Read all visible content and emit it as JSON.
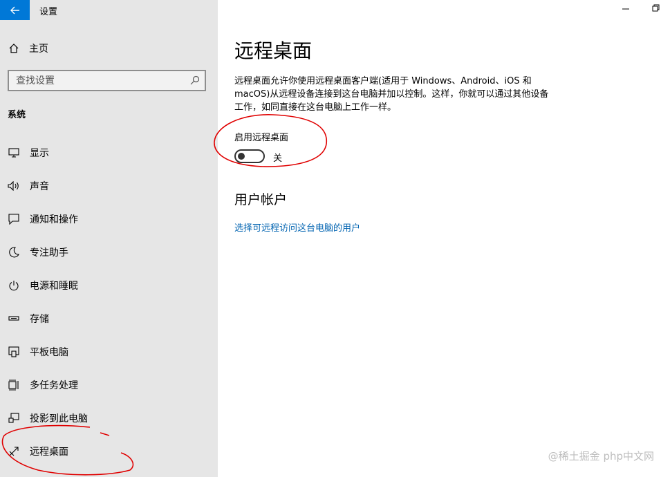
{
  "app": {
    "title": "设置"
  },
  "sidebar": {
    "home_label": "主页",
    "search_placeholder": "查找设置",
    "section": "系统",
    "items": [
      {
        "label": "显示",
        "icon": "monitor-icon"
      },
      {
        "label": "声音",
        "icon": "speaker-icon"
      },
      {
        "label": "通知和操作",
        "icon": "notification-icon"
      },
      {
        "label": "专注助手",
        "icon": "moon-icon"
      },
      {
        "label": "电源和睡眠",
        "icon": "power-icon"
      },
      {
        "label": "存储",
        "icon": "storage-icon"
      },
      {
        "label": "平板电脑",
        "icon": "tablet-icon"
      },
      {
        "label": "多任务处理",
        "icon": "multitask-icon"
      },
      {
        "label": "投影到此电脑",
        "icon": "project-icon"
      },
      {
        "label": "远程桌面",
        "icon": "remote-desktop-icon"
      }
    ]
  },
  "main": {
    "title": "远程桌面",
    "description": "远程桌面允许你使用远程桌面客户端(适用于 Windows、Android、iOS 和 macOS)从远程设备连接到这台电脑并加以控制。这样，你就可以通过其他设备工作，如同直接在这台电脑上工作一样。",
    "toggle_label": "启用远程桌面",
    "toggle_state": "关",
    "toggle_on": false,
    "user_accounts_title": "用户帐户",
    "user_accounts_link": "选择可远程访问这台电脑的用户"
  },
  "watermark": "@稀土掘金 php中文网",
  "colors": {
    "accent": "#0078d7",
    "link": "#0063b1",
    "sidebar_bg": "#e6e6e6",
    "annotation": "#e00000"
  }
}
